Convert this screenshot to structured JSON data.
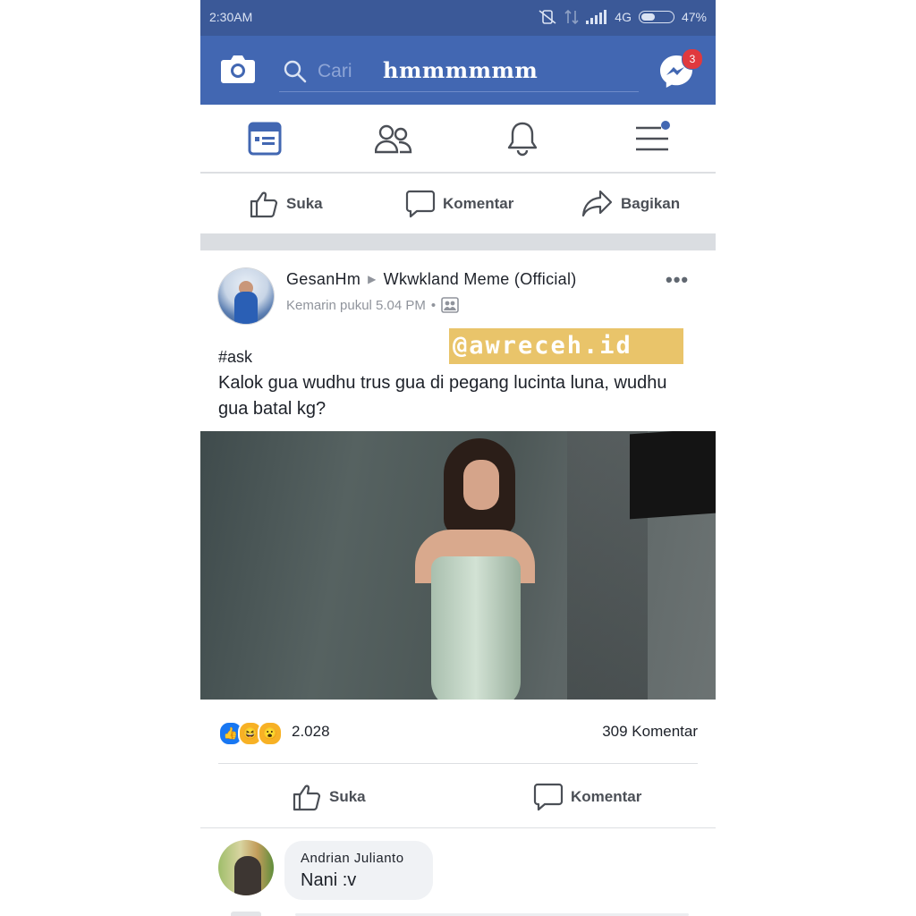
{
  "status_bar": {
    "time": "2:30AM",
    "network": "4G",
    "battery": "47%",
    "battery_level": 0.47
  },
  "top_bar": {
    "search_placeholder": "Cari",
    "search_text": "hmmmmmm",
    "messenger_badge": "3",
    "brand_color": "#4267b2"
  },
  "nav_tabs": [
    "feed-icon",
    "friends-icon",
    "bell-icon",
    "menu-icon"
  ],
  "top_actions": {
    "like": "Suka",
    "comment": "Komentar",
    "share": "Bagikan"
  },
  "post": {
    "author": "GesanHm",
    "group": "Wkwkland Meme (Official)",
    "timestamp": "Kemarin pukul 5.04 PM",
    "watermark": "@awreceh.id",
    "hashtag": "#ask",
    "text": "Kalok gua wudhu trus gua di pegang lucinta luna, wudhu gua batal kg?",
    "reaction_count": "2.028",
    "comment_count": "309 Komentar",
    "like_label": "Suka",
    "comment_label": "Komentar"
  },
  "comment": {
    "name": "Andrian Julianto",
    "text": "Nani :v"
  }
}
